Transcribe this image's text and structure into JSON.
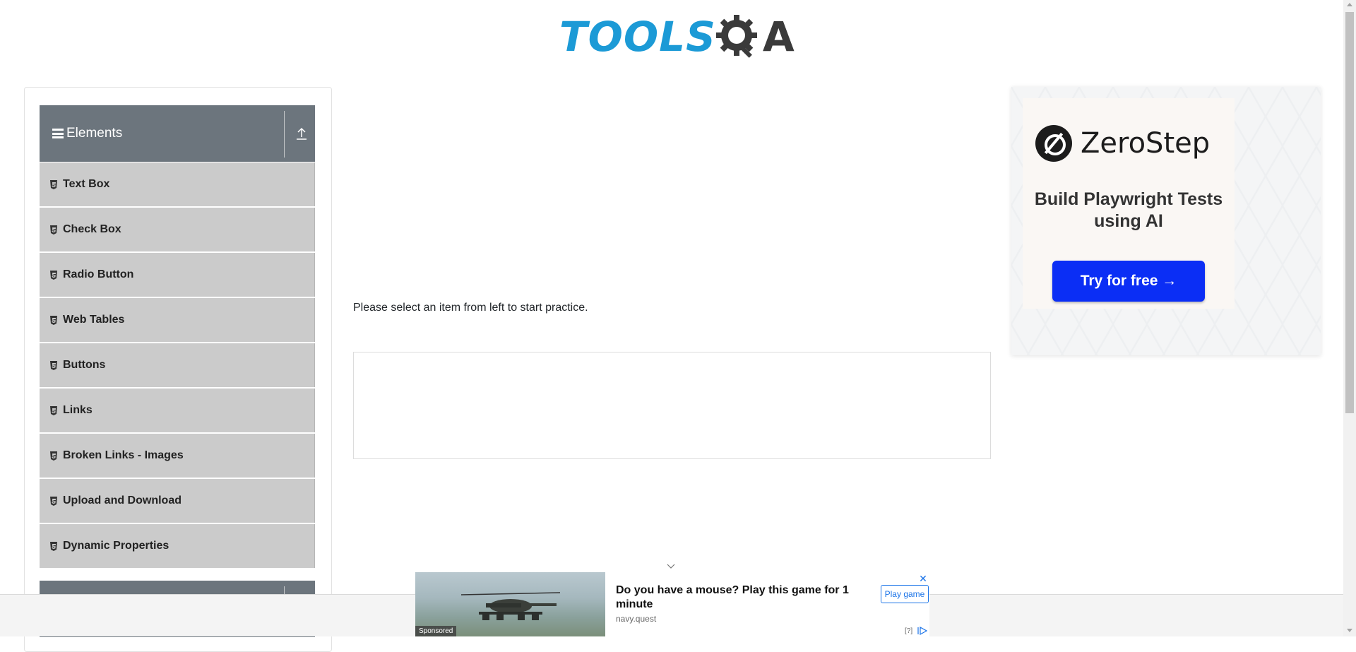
{
  "header": {
    "logo_text": "TOOLS",
    "logo_suffix": "A"
  },
  "sidebar": {
    "group_title": "Elements",
    "items": [
      {
        "label": "Text Box"
      },
      {
        "label": "Check Box"
      },
      {
        "label": "Radio Button"
      },
      {
        "label": "Web Tables"
      },
      {
        "label": "Buttons"
      },
      {
        "label": "Links"
      },
      {
        "label": "Broken Links - Images"
      },
      {
        "label": "Upload and Download"
      },
      {
        "label": "Dynamic Properties"
      }
    ]
  },
  "main": {
    "instruction": "Please select an item from left to start practice."
  },
  "right_ad": {
    "brand": "ZeroStep",
    "tagline": "Build Playwright Tests using AI",
    "cta": "Try for free →"
  },
  "bottom_ad": {
    "sponsored": "Sponsored",
    "headline": "Do you have a mouse? Play this game for 1 minute",
    "domain": "navy.quest",
    "button": "Play game",
    "close": "✕",
    "question": "[?]"
  },
  "colors": {
    "logo_blue": "#1c9ad6",
    "group_header": "#6c757d",
    "menu_item": "#cbcbcb",
    "cta_blue": "#0b2ef5"
  }
}
